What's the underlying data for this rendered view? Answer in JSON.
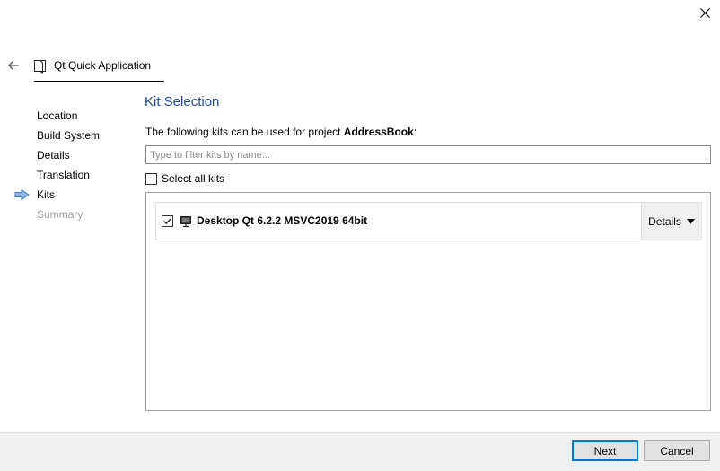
{
  "window": {
    "close_icon": "close-icon"
  },
  "header": {
    "back_icon": "back-arrow-icon",
    "wizard_icon": "document-icon",
    "title": "Qt Quick Application"
  },
  "steps": [
    {
      "label": "Location",
      "state": "done"
    },
    {
      "label": "Build System",
      "state": "done"
    },
    {
      "label": "Details",
      "state": "done"
    },
    {
      "label": "Translation",
      "state": "done"
    },
    {
      "label": "Kits",
      "state": "current"
    },
    {
      "label": "Summary",
      "state": "disabled"
    }
  ],
  "page": {
    "heading": "Kit Selection",
    "description_prefix": "The following kits can be used for project ",
    "project_name": "AddressBook",
    "description_suffix": ":",
    "filter_placeholder": "Type to filter kits by name...",
    "filter_value": "",
    "select_all_label": "Select all kits",
    "select_all_checked": false
  },
  "kits": [
    {
      "name": "Desktop Qt 6.2.2 MSVC2019 64bit",
      "checked": true,
      "icon": "monitor-icon",
      "details_label": "Details"
    }
  ],
  "footer": {
    "next_label": "Next",
    "cancel_label": "Cancel"
  },
  "colors": {
    "heading": "#1c4a9c",
    "current_step_arrow": "#4a90d9",
    "default_button_border": "#0078d7"
  }
}
